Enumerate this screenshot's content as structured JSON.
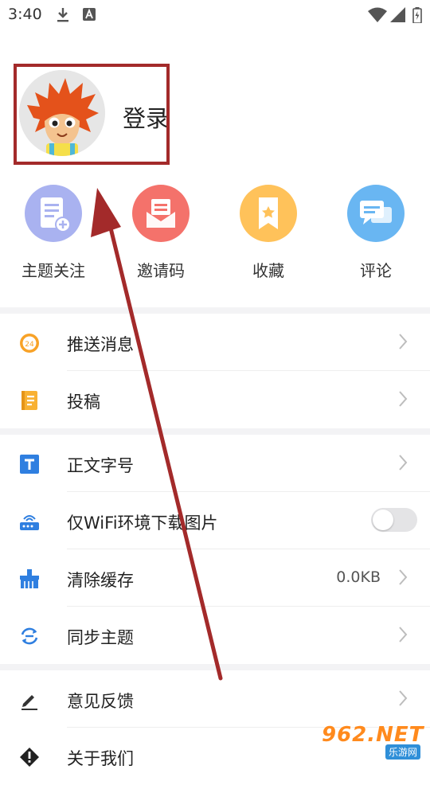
{
  "status_bar": {
    "time": "3:40"
  },
  "profile": {
    "login_label": "登录"
  },
  "quick_actions": [
    {
      "label": "主题关注",
      "icon": "document-add-icon",
      "color": "#a9b2f0"
    },
    {
      "label": "邀请码",
      "icon": "envelope-icon",
      "color": "#f4726b"
    },
    {
      "label": "收藏",
      "icon": "bookmark-icon",
      "color": "#ffc25a"
    },
    {
      "label": "评论",
      "icon": "chat-bubbles-icon",
      "color": "#69b6f2"
    }
  ],
  "menu_group_1": [
    {
      "label": "推送消息",
      "icon": "24h-badge-icon"
    },
    {
      "label": "投稿",
      "icon": "notebook-icon"
    }
  ],
  "menu_group_2": [
    {
      "label": "正文字号",
      "icon": "text-size-icon"
    },
    {
      "label": "仅WiFi环境下载图片",
      "icon": "router-icon",
      "toggle_on": false
    },
    {
      "label": "清除缓存",
      "icon": "broom-icon",
      "value": "0.0KB"
    },
    {
      "label": "同步主题",
      "icon": "sync-icon"
    }
  ],
  "menu_group_3": [
    {
      "label": "意见反馈",
      "icon": "pencil-icon"
    },
    {
      "label": "关于我们",
      "icon": "info-diamond-icon"
    }
  ],
  "watermark": {
    "big": "962.NET",
    "small": "乐游网"
  },
  "colors": {
    "highlight": "#a32a2a",
    "accent_blue": "#2f7fe0",
    "divider": "#f3f3f5"
  }
}
